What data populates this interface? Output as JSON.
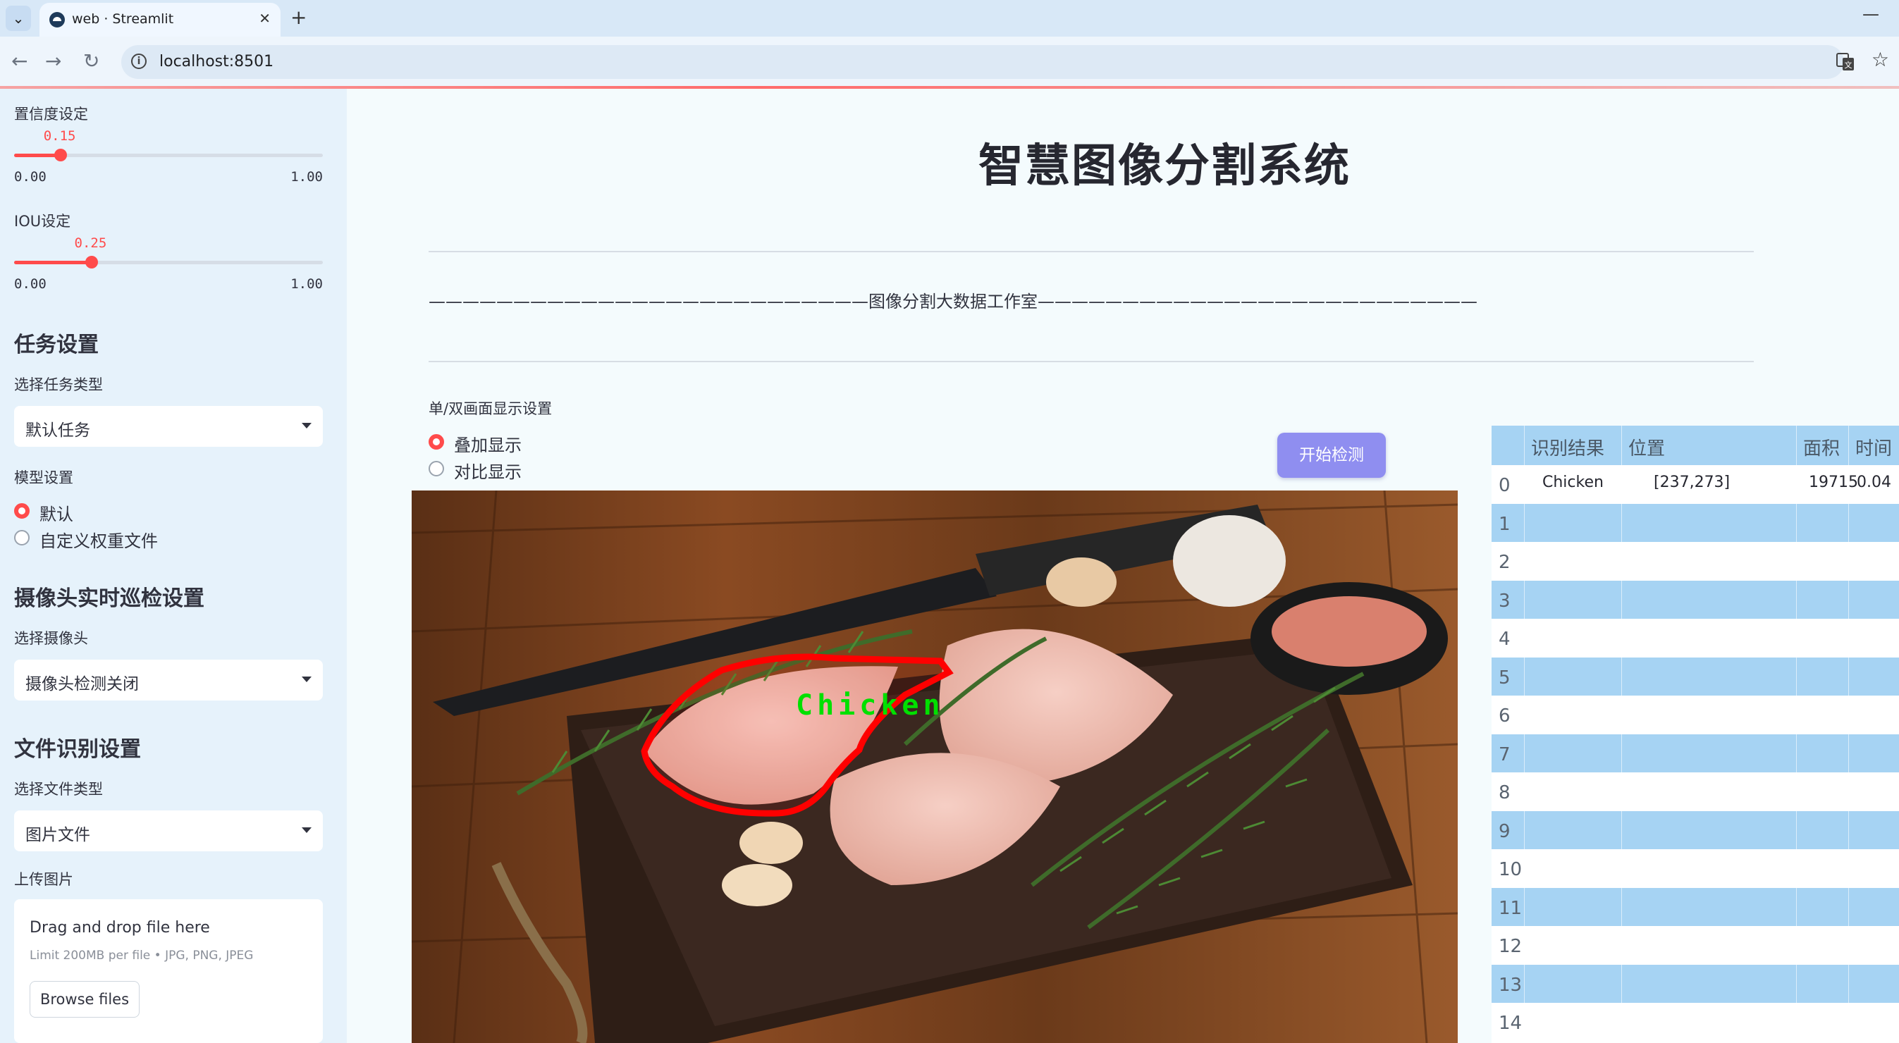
{
  "browser": {
    "tab_title": "web · Streamlit",
    "url": "localhost:8501"
  },
  "sidebar": {
    "confidence": {
      "label": "置信度设定",
      "value": "0.15",
      "min": "0.00",
      "max": "1.00",
      "fraction": 0.15
    },
    "iou": {
      "label": "IOU设定",
      "value": "0.25",
      "min": "0.00",
      "max": "1.00",
      "fraction": 0.25
    },
    "task": {
      "header": "任务设置",
      "select_label": "选择任务类型",
      "selected": "默认任务"
    },
    "model": {
      "label": "模型设置",
      "options": [
        "默认",
        "自定义权重文件"
      ],
      "selected_index": 0
    },
    "camera": {
      "header": "摄像头实时巡检设置",
      "select_label": "选择摄像头",
      "selected": "摄像头检测关闭"
    },
    "file": {
      "header": "文件识别设置",
      "select_label": "选择文件类型",
      "selected": "图片文件"
    },
    "upload": {
      "label": "上传图片",
      "drop_text": "Drag and drop file here",
      "limit_text": "Limit 200MB per file • JPG, PNG, JPEG",
      "browse_label": "Browse files"
    }
  },
  "main": {
    "title": "智慧图像分割系统",
    "banner": "——————————————————————————图像分割大数据工作室——————————————————————————",
    "display": {
      "label": "单/双画面显示设置",
      "options": [
        "叠加显示",
        "对比显示"
      ],
      "selected_index": 0
    },
    "detect_button": "开始检测",
    "detection_label": "Chicken"
  },
  "results_table": {
    "columns": [
      "识别结果",
      "位置",
      "面积",
      "时间"
    ],
    "row_indices": [
      "0",
      "1",
      "2",
      "3",
      "4",
      "5",
      "6",
      "7",
      "8",
      "9",
      "10",
      "11",
      "12",
      "13",
      "14"
    ],
    "rows": [
      {
        "result": "Chicken",
        "position": "[237,273]",
        "area": "19715",
        "time": "0.04"
      }
    ]
  },
  "colors": {
    "accent": "#ff4b4b",
    "button": "#8f8ef0",
    "table_stripe": "#a6d3f3",
    "sidebar_bg": "#e6f2fb",
    "mask_outline": "#ff0000",
    "mask_label": "#00e000"
  }
}
